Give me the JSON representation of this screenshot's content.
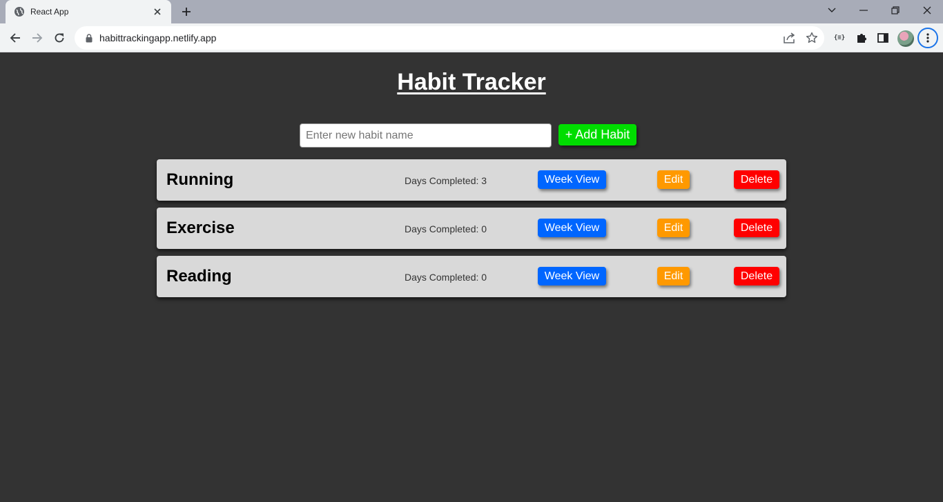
{
  "browser": {
    "tab_title": "React App",
    "url": "habittrackingapp.netlify.app",
    "extension_label": "{≡}"
  },
  "app": {
    "title": "Habit Tracker",
    "input_placeholder": "Enter new habit name",
    "input_value": "",
    "add_button_label": "+ Add Habit",
    "colors": {
      "background": "#333333",
      "add": "#00dd00",
      "week_view": "#0066ff",
      "edit": "#ff9900",
      "delete": "#ff0000",
      "card": "#d9d9d9"
    },
    "habits": [
      {
        "name": "Running",
        "days": "Days Completed: 3",
        "week_label": "Week View",
        "edit_label": "Edit",
        "delete_label": "Delete"
      },
      {
        "name": "Exercise",
        "days": "Days Completed: 0",
        "week_label": "Week View",
        "edit_label": "Edit",
        "delete_label": "Delete"
      },
      {
        "name": "Reading",
        "days": "Days Completed: 0",
        "week_label": "Week View",
        "edit_label": "Edit",
        "delete_label": "Delete"
      }
    ]
  }
}
